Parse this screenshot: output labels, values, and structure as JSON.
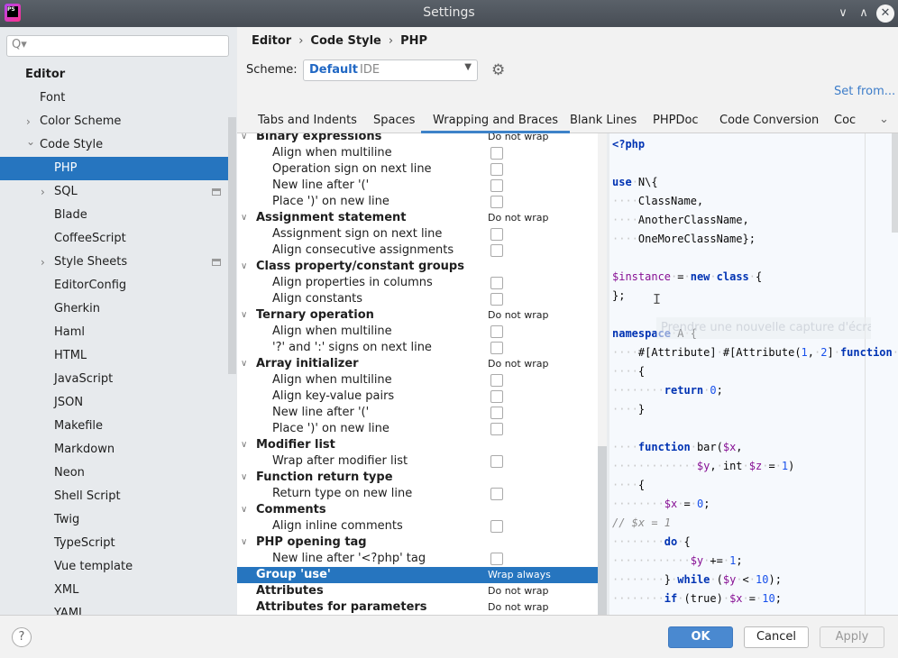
{
  "window": {
    "title": "Settings",
    "logo": "PS",
    "controls": [
      "minimize",
      "maximize",
      "close"
    ]
  },
  "sidebar": {
    "search_placeholder": "Q▾",
    "items": [
      {
        "label": "Editor",
        "level": 0,
        "bold": true
      },
      {
        "label": "Font",
        "level": 1
      },
      {
        "label": "Color Scheme",
        "level": 1,
        "expandable": true
      },
      {
        "label": "Code Style",
        "level": 1,
        "expanded": true
      },
      {
        "label": "PHP",
        "level": 2,
        "selected": true
      },
      {
        "label": "SQL",
        "level": 2,
        "expandable": true,
        "badge": true
      },
      {
        "label": "Blade",
        "level": 2
      },
      {
        "label": "CoffeeScript",
        "level": 2
      },
      {
        "label": "Style Sheets",
        "level": 2,
        "expandable": true,
        "badge": true
      },
      {
        "label": "EditorConfig",
        "level": 2
      },
      {
        "label": "Gherkin",
        "level": 2
      },
      {
        "label": "Haml",
        "level": 2
      },
      {
        "label": "HTML",
        "level": 2
      },
      {
        "label": "JavaScript",
        "level": 2
      },
      {
        "label": "JSON",
        "level": 2
      },
      {
        "label": "Makefile",
        "level": 2
      },
      {
        "label": "Markdown",
        "level": 2
      },
      {
        "label": "Neon",
        "level": 2
      },
      {
        "label": "Shell Script",
        "level": 2
      },
      {
        "label": "Twig",
        "level": 2
      },
      {
        "label": "TypeScript",
        "level": 2
      },
      {
        "label": "Vue template",
        "level": 2
      },
      {
        "label": "XML",
        "level": 2
      },
      {
        "label": "YAML",
        "level": 2
      }
    ]
  },
  "breadcrumb": [
    "Editor",
    "Code Style",
    "PHP"
  ],
  "scheme": {
    "label": "Scheme:",
    "value": "Default",
    "sub": "IDE"
  },
  "set_from": "Set from...",
  "tabs": [
    "Tabs and Indents",
    "Spaces",
    "Wrapping and Braces",
    "Blank Lines",
    "PHPDoc",
    "Code Conversion",
    "Coc"
  ],
  "active_tab": "Wrapping and Braces",
  "options": [
    {
      "label": "Binary expressions",
      "group": true,
      "value": "Do not wrap"
    },
    {
      "label": "Align when multiline",
      "checked": false
    },
    {
      "label": "Operation sign on next line",
      "checked": false
    },
    {
      "label": "New line after '('",
      "checked": false
    },
    {
      "label": "Place ')' on new line",
      "checked": false
    },
    {
      "label": "Assignment statement",
      "group": true,
      "value": "Do not wrap"
    },
    {
      "label": "Assignment sign on next line",
      "checked": false
    },
    {
      "label": "Align consecutive assignments",
      "checked": false
    },
    {
      "label": "Class property/constant groups",
      "group": true
    },
    {
      "label": "Align properties in columns",
      "checked": false
    },
    {
      "label": "Align constants",
      "checked": false
    },
    {
      "label": "Ternary operation",
      "group": true,
      "value": "Do not wrap"
    },
    {
      "label": "Align when multiline",
      "checked": false
    },
    {
      "label": "'?' and ':' signs on next line",
      "checked": false
    },
    {
      "label": "Array initializer",
      "group": true,
      "value": "Do not wrap"
    },
    {
      "label": "Align when multiline",
      "checked": false
    },
    {
      "label": "Align key-value pairs",
      "checked": false
    },
    {
      "label": "New line after '('",
      "checked": false
    },
    {
      "label": "Place ')' on new line",
      "checked": false
    },
    {
      "label": "Modifier list",
      "group": true
    },
    {
      "label": "Wrap after modifier list",
      "checked": false
    },
    {
      "label": "Function return type",
      "group": true
    },
    {
      "label": "Return type on new line",
      "checked": false
    },
    {
      "label": "Comments",
      "group": true
    },
    {
      "label": "Align inline comments",
      "checked": false
    },
    {
      "label": "PHP opening tag",
      "group": true
    },
    {
      "label": "New line after '<?php' tag",
      "checked": false
    },
    {
      "label": "Group 'use'",
      "group": true,
      "leaf": true,
      "value": "Wrap always",
      "selected": true
    },
    {
      "label": "Attributes",
      "group": true,
      "leaf": true,
      "value": "Do not wrap"
    },
    {
      "label": "Attributes for parameters",
      "group": true,
      "leaf": true,
      "value": "Do not wrap"
    }
  ],
  "code": [
    [
      [
        "kw",
        "<?php"
      ]
    ],
    [],
    [
      [
        "kw",
        "use"
      ],
      [
        "ws",
        "·"
      ],
      [
        "",
        "N\\{"
      ]
    ],
    [
      [
        "ws",
        "····"
      ],
      [
        "",
        "ClassName,"
      ]
    ],
    [
      [
        "ws",
        "····"
      ],
      [
        "",
        "AnotherClassName,"
      ]
    ],
    [
      [
        "ws",
        "····"
      ],
      [
        "",
        "OneMoreClassName};"
      ]
    ],
    [],
    [
      [
        "var",
        "$instance"
      ],
      [
        "ws",
        "·"
      ],
      [
        "",
        "="
      ],
      [
        "ws",
        "·"
      ],
      [
        "kw",
        "new"
      ],
      [
        "ws",
        "·"
      ],
      [
        "kw",
        "class"
      ],
      [
        "ws",
        "·"
      ],
      [
        "",
        "{"
      ]
    ],
    [
      [
        "",
        "};"
      ]
    ],
    [],
    [
      [
        "kw",
        "namespace"
      ],
      [
        "ws",
        "·"
      ],
      [
        "",
        "A"
      ],
      [
        "ws",
        "·"
      ],
      [
        "",
        "{"
      ]
    ],
    [
      [
        "ws",
        "····"
      ],
      [
        "",
        "#[Attribute]"
      ],
      [
        "ws",
        "·"
      ],
      [
        "",
        "#[Attribute("
      ],
      [
        "num",
        "1"
      ],
      [
        "",
        ","
      ],
      [
        "ws",
        "·"
      ],
      [
        "num",
        "2"
      ],
      [
        "",
        "]"
      ],
      [
        "ws",
        "·"
      ],
      [
        "kw",
        "function"
      ],
      [
        "ws",
        "·"
      ],
      [
        "",
        "f"
      ]
    ],
    [
      [
        "ws",
        "····"
      ],
      [
        "",
        "{"
      ]
    ],
    [
      [
        "ws",
        "········"
      ],
      [
        "kw",
        "return"
      ],
      [
        "ws",
        "·"
      ],
      [
        "num",
        "0"
      ],
      [
        "",
        ";"
      ]
    ],
    [
      [
        "ws",
        "····"
      ],
      [
        "",
        "}"
      ]
    ],
    [],
    [
      [
        "ws",
        "····"
      ],
      [
        "kw",
        "function"
      ],
      [
        "ws",
        "·"
      ],
      [
        "",
        "bar("
      ],
      [
        "var",
        "$x"
      ],
      [
        "",
        ","
      ]
    ],
    [
      [
        "ws",
        "·············"
      ],
      [
        "var",
        "$y"
      ],
      [
        "",
        ","
      ],
      [
        "ws",
        "·"
      ],
      [
        "",
        "int"
      ],
      [
        "ws",
        "·"
      ],
      [
        "var",
        "$z"
      ],
      [
        "ws",
        "·"
      ],
      [
        "",
        "="
      ],
      [
        "ws",
        "·"
      ],
      [
        "num",
        "1"
      ],
      [
        "",
        ")"
      ]
    ],
    [
      [
        "ws",
        "····"
      ],
      [
        "",
        "{"
      ]
    ],
    [
      [
        "ws",
        "········"
      ],
      [
        "var",
        "$x"
      ],
      [
        "ws",
        "·"
      ],
      [
        "",
        "="
      ],
      [
        "ws",
        "·"
      ],
      [
        "num",
        "0"
      ],
      [
        "",
        ";"
      ]
    ],
    [
      [
        "cm",
        "// $x = 1"
      ]
    ],
    [
      [
        "ws",
        "········"
      ],
      [
        "kw",
        "do"
      ],
      [
        "ws",
        "·"
      ],
      [
        "",
        "{"
      ]
    ],
    [
      [
        "ws",
        "············"
      ],
      [
        "var",
        "$y"
      ],
      [
        "ws",
        "·"
      ],
      [
        "",
        "+="
      ],
      [
        "ws",
        "·"
      ],
      [
        "num",
        "1"
      ],
      [
        "",
        ";"
      ]
    ],
    [
      [
        "ws",
        "········"
      ],
      [
        "",
        "}"
      ],
      [
        "ws",
        "·"
      ],
      [
        "kw",
        "while"
      ],
      [
        "ws",
        "·"
      ],
      [
        "",
        "("
      ],
      [
        "var",
        "$y"
      ],
      [
        "ws",
        "·"
      ],
      [
        "",
        "<"
      ],
      [
        "ws",
        "·"
      ],
      [
        "num",
        "10"
      ],
      [
        "",
        ");"
      ]
    ],
    [
      [
        "ws",
        "········"
      ],
      [
        "kw",
        "if"
      ],
      [
        "ws",
        "·"
      ],
      [
        "",
        "(true)"
      ],
      [
        "ws",
        "·"
      ],
      [
        "var",
        "$x"
      ],
      [
        "ws",
        "·"
      ],
      [
        "",
        "="
      ],
      [
        "ws",
        "·"
      ],
      [
        "num",
        "10"
      ],
      [
        "",
        ";"
      ]
    ]
  ],
  "tooltip": "Prendre une nouvelle capture d'écran",
  "buttons": {
    "help": "?",
    "ok": "OK",
    "cancel": "Cancel",
    "apply": "Apply"
  },
  "colors": {
    "accent": "#2675bf",
    "ok": "#4a89d0",
    "link": "#3d7dc9"
  }
}
